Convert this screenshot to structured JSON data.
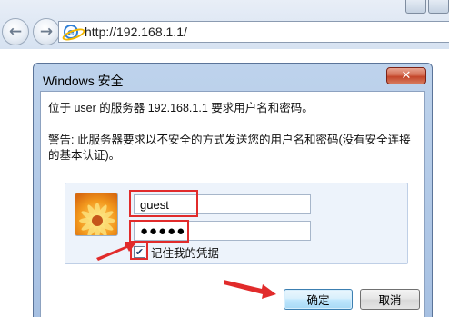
{
  "browser": {
    "address": "http://192.168.1.1/",
    "back_icon": "back-arrow-icon",
    "forward_icon": "forward-arrow-icon",
    "page_icon": "internet-explorer-icon"
  },
  "dialog": {
    "title": "Windows 安全",
    "close_label": "✕",
    "message": "位于 user 的服务器 192.168.1.1 要求用户名和密码。",
    "warning": "警告: 此服务器要求以不安全的方式发送您的用户名和密码(没有安全连接的基本认证)。",
    "username_value": "guest",
    "password_value": "●●●●●",
    "remember_checked": true,
    "remember_label": "记住我的凭据",
    "ok_label": "确定",
    "cancel_label": "取消"
  },
  "annotations": {
    "highlight_color": "#e12b2b",
    "arrow_color": "#e12b2b"
  },
  "colors": {
    "dialog_frame": "#bed3ec",
    "default_button": "#bee6fd"
  }
}
